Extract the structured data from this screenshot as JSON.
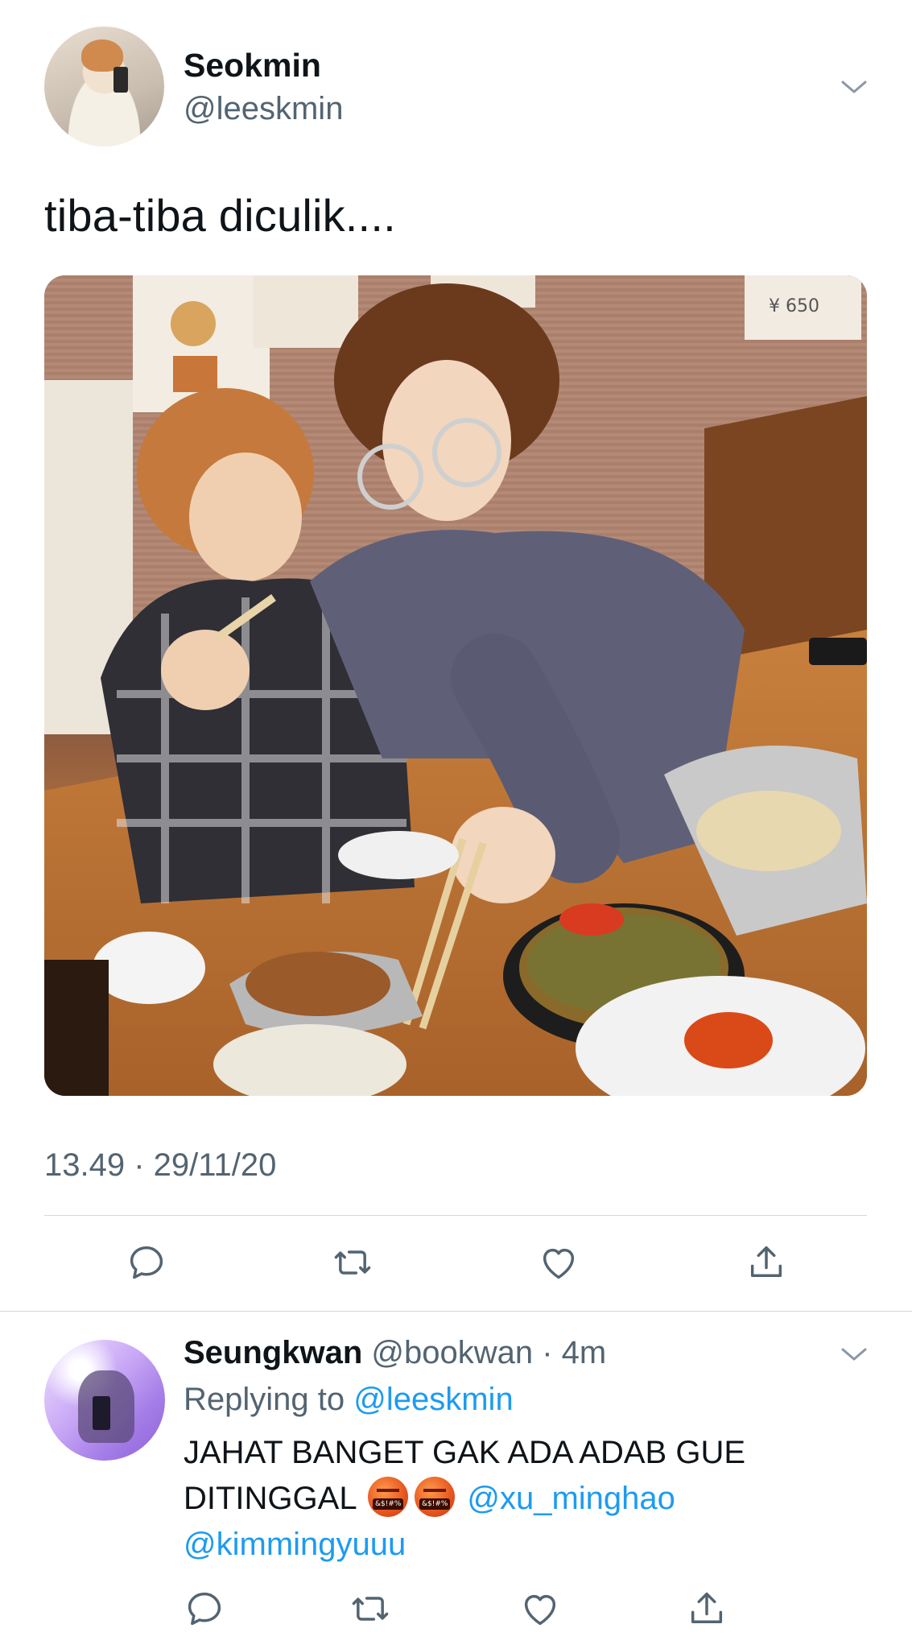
{
  "tweet": {
    "author_name": "Seokmin",
    "author_handle": "@leeskmin",
    "text": "tiba-tiba diculik....",
    "timestamp": "13.49 · 29/11/20",
    "photo_price_tag": "¥ 650",
    "avatar_icon": "profile-avatar",
    "more_icon": "chevron-down-icon"
  },
  "actions": [
    {
      "name": "reply",
      "icon": "comment-icon"
    },
    {
      "name": "retweet",
      "icon": "retweet-icon"
    },
    {
      "name": "like",
      "icon": "heart-icon"
    },
    {
      "name": "share",
      "icon": "share-icon"
    }
  ],
  "reply": {
    "author_name": "Seungkwan",
    "author_handle": "@bookwan",
    "separator": " · ",
    "time": "4m",
    "replying_prefix": "Replying to",
    "replying_to": "@leeskmin",
    "text_part1": "JAHAT BANGET GAK ADA ADAB GUE DITINGGAL",
    "emoji_label": "&$!#%",
    "mention1": "@xu_minghao",
    "mention2": "@kimmingyuuu"
  },
  "colors": {
    "text": "#0f1419",
    "secondary": "#536471",
    "link": "#1d9bf0",
    "divider": "#cfd9de"
  }
}
